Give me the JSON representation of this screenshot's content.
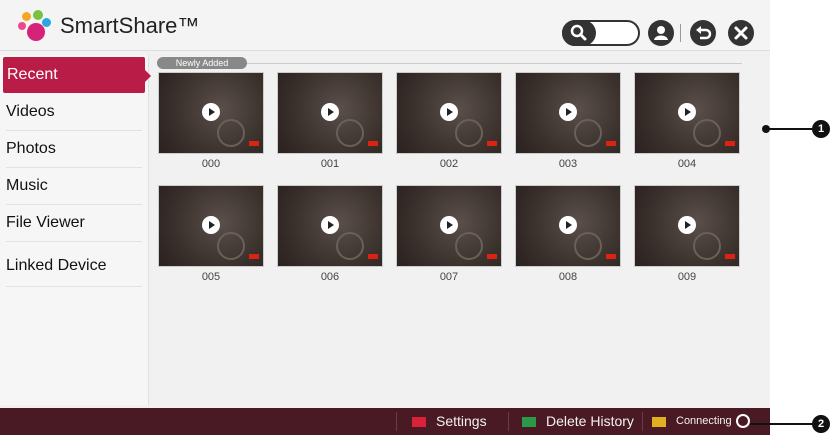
{
  "app": {
    "title": "SmartShare™"
  },
  "header": {
    "icons": [
      "search-icon",
      "user-icon",
      "back-icon",
      "close-icon"
    ]
  },
  "sidebar": {
    "items": [
      {
        "label": "Recent",
        "active": true
      },
      {
        "label": "Videos"
      },
      {
        "label": "Photos"
      },
      {
        "label": "Music"
      },
      {
        "label": "File Viewer"
      },
      {
        "label": "Linked Device"
      }
    ]
  },
  "main": {
    "section_label": "Newly Added",
    "items": [
      {
        "caption": "000"
      },
      {
        "caption": "001"
      },
      {
        "caption": "002"
      },
      {
        "caption": "003"
      },
      {
        "caption": "004"
      },
      {
        "caption": "005"
      },
      {
        "caption": "006"
      },
      {
        "caption": "007"
      },
      {
        "caption": "008"
      },
      {
        "caption": "009"
      }
    ]
  },
  "bottombar": {
    "settings_label": "Settings",
    "delete_history_label": "Delete History",
    "connecting_label": "Connecting",
    "key_colors": {
      "red": "#d9223a",
      "green": "#2a9a4a",
      "yellow": "#e0b020"
    }
  },
  "callouts": [
    "1",
    "2"
  ],
  "colors": {
    "accent": "#b91d47",
    "bottombar": "#4a1a24"
  }
}
